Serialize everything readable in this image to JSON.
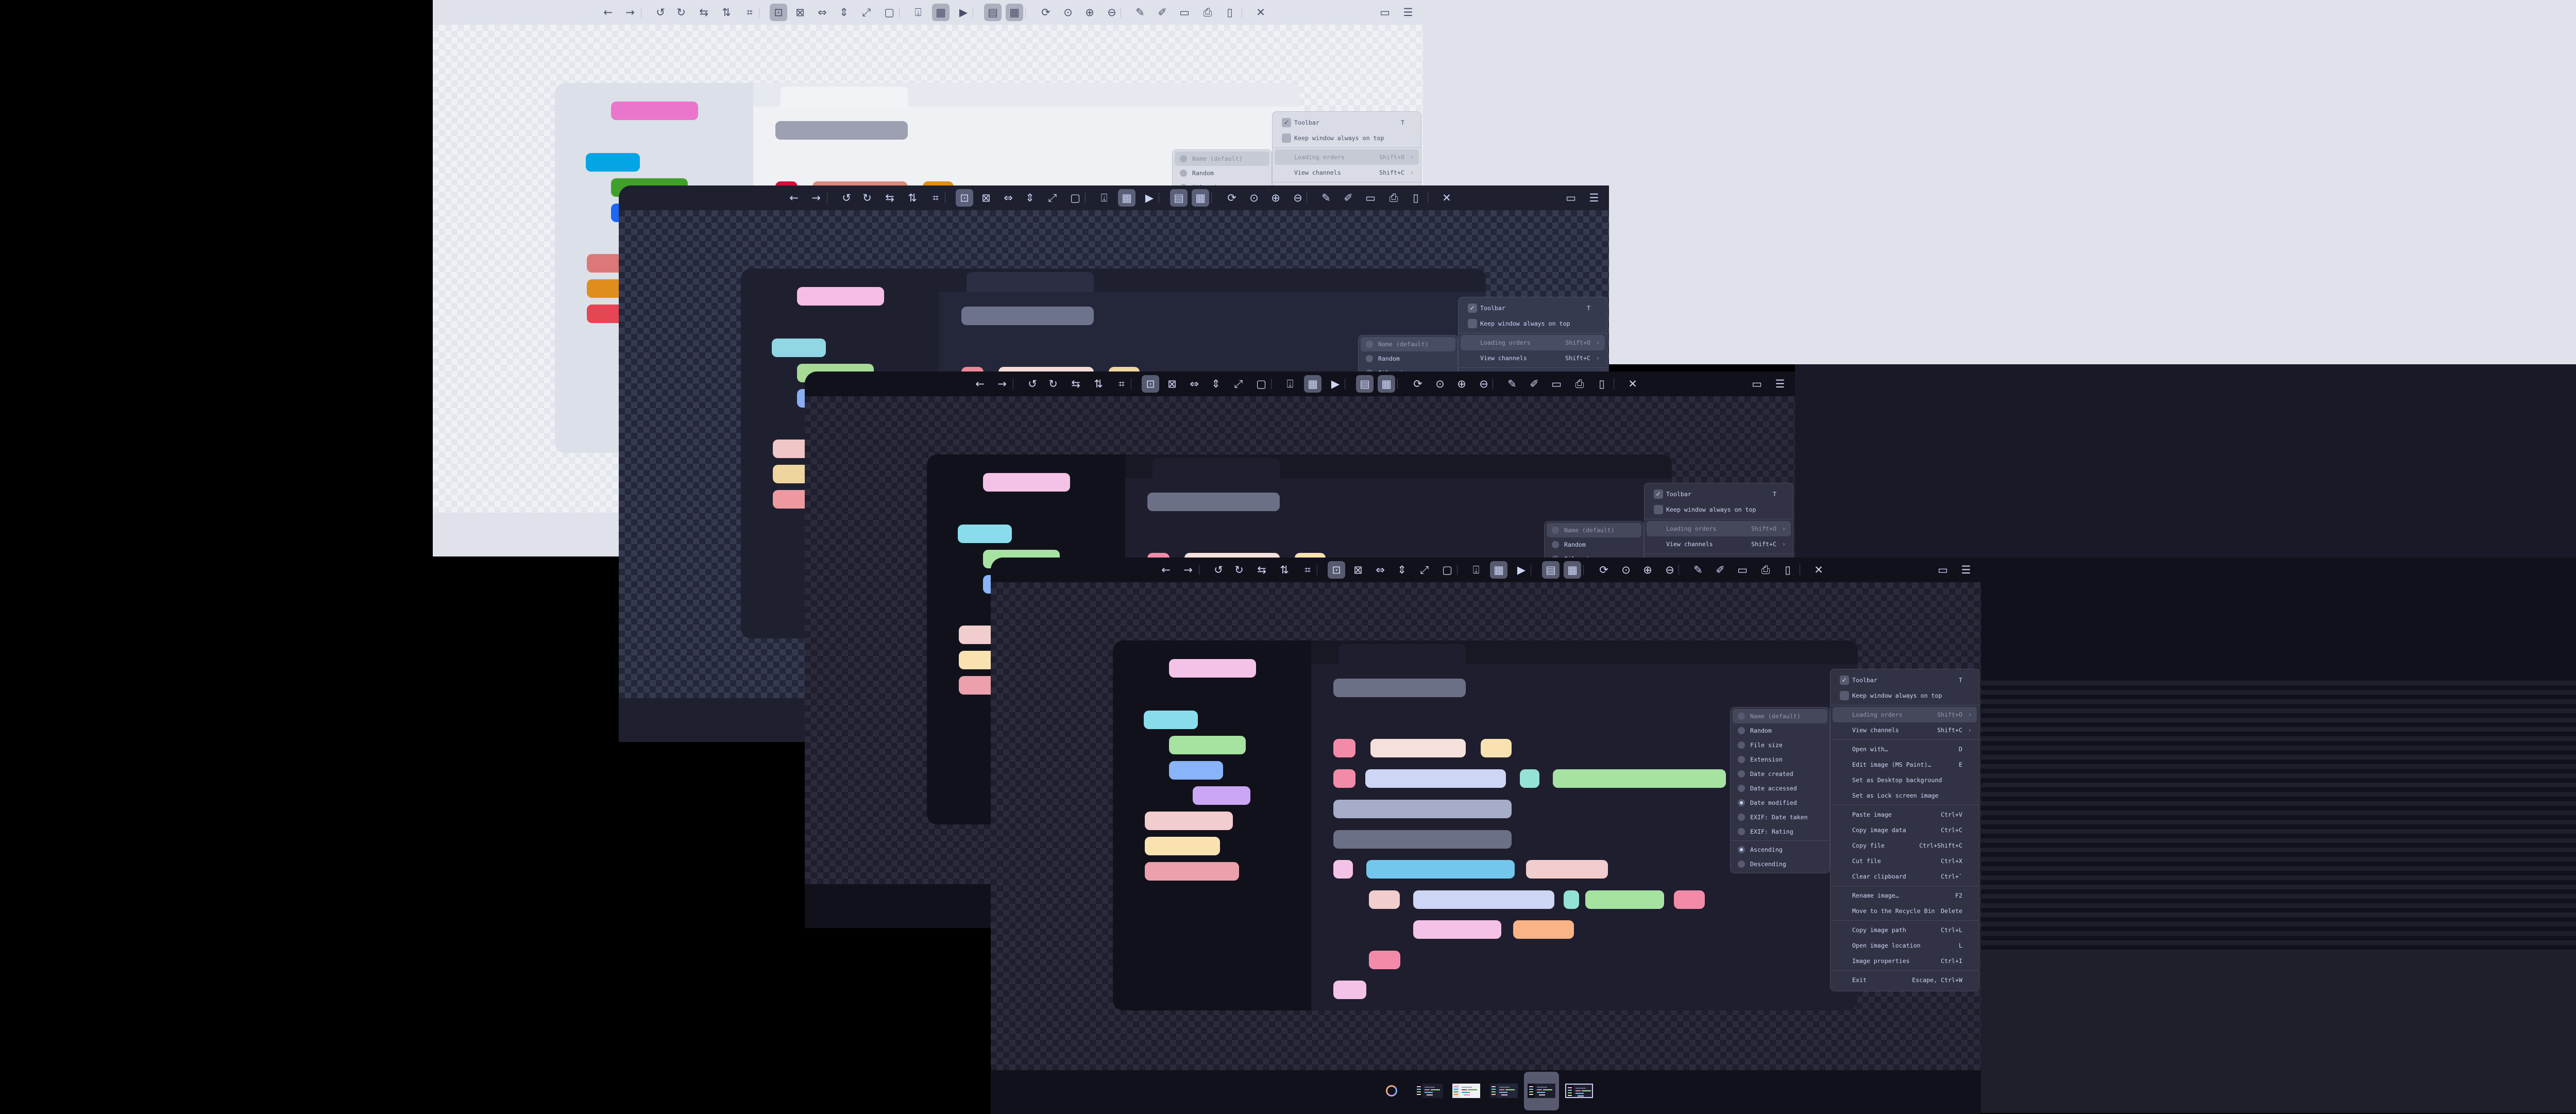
{
  "toolbar": {
    "items": [
      {
        "icon": "arrow-left-icon",
        "label": "Previous image",
        "active": false
      },
      {
        "icon": "arrow-right-icon",
        "label": "Next image",
        "active": false
      },
      {
        "icon": "rotate-left-icon",
        "label": "Rotate left",
        "active": false
      },
      {
        "icon": "rotate-right-icon",
        "label": "Rotate right",
        "active": false
      },
      {
        "icon": "flip-horizontal-icon",
        "label": "Flip horizontal",
        "active": false
      },
      {
        "icon": "flip-vertical-icon",
        "label": "Flip vertical",
        "active": false
      },
      {
        "icon": "crop-icon",
        "label": "Crop",
        "active": false
      },
      {
        "icon": "auto-zoom-icon",
        "label": "Auto zoom",
        "active": true
      },
      {
        "icon": "lock-zoom-icon",
        "label": "Lock zoom",
        "active": false
      },
      {
        "icon": "scale-to-width-icon",
        "label": "Scale to width",
        "active": false
      },
      {
        "icon": "scale-to-height-icon",
        "label": "Scale to height",
        "active": false
      },
      {
        "icon": "scale-to-fill-icon",
        "label": "Scale to fill",
        "active": false
      },
      {
        "icon": "original-size-icon",
        "label": "Original size",
        "active": false
      },
      {
        "icon": "toggle-toolbar-icon",
        "label": "Toolbar",
        "active": false
      },
      {
        "icon": "checkerboard-icon",
        "label": "Checkerboard",
        "active": true
      },
      {
        "icon": "slideshow-icon",
        "label": "Slideshow",
        "active": false
      },
      {
        "icon": "thumbnail-bar-icon",
        "label": "Thumbnail bar",
        "active": true
      },
      {
        "icon": "gallery-icon",
        "label": "Gallery",
        "active": true
      },
      {
        "icon": "refresh-icon",
        "label": "Refresh",
        "active": false
      },
      {
        "icon": "zoom-fit-icon",
        "label": "Zoom to fit",
        "active": false
      },
      {
        "icon": "zoom-in-icon",
        "label": "Zoom in",
        "active": false
      },
      {
        "icon": "zoom-out-icon",
        "label": "Zoom out",
        "active": false
      },
      {
        "icon": "color-picker-icon",
        "label": "Color picker",
        "active": false
      },
      {
        "icon": "edit-icon",
        "label": "Edit",
        "active": false
      },
      {
        "icon": "save-icon",
        "label": "Save",
        "active": false
      },
      {
        "icon": "print-icon",
        "label": "Print",
        "active": false
      },
      {
        "icon": "delete-icon",
        "label": "Delete",
        "active": false
      },
      {
        "icon": "close-icon",
        "label": "Close",
        "active": false
      }
    ],
    "right_items": [
      {
        "icon": "folder-icon",
        "label": "Open file"
      },
      {
        "icon": "hamburger-menu-icon",
        "label": "Main menu"
      }
    ]
  },
  "context_menu": {
    "sections": [
      [
        {
          "label": "Toolbar",
          "shortcut": "T",
          "checkbox": true,
          "checked": true
        },
        {
          "label": "Keep window always on top",
          "shortcut": "",
          "checkbox": true,
          "checked": false
        }
      ],
      [
        {
          "label": "Loading orders",
          "shortcut": "Shift+O",
          "submenu": true,
          "highlighted": true
        },
        {
          "label": "View channels",
          "shortcut": "Shift+C",
          "submenu": true
        }
      ],
      [
        {
          "label": "Open with…",
          "shortcut": "D"
        },
        {
          "label": "Edit image (MS Paint)…",
          "shortcut": "E"
        },
        {
          "label": "Set as Desktop background",
          "shortcut": ""
        },
        {
          "label": "Set as Lock screen image",
          "shortcut": ""
        }
      ],
      [
        {
          "label": "Paste image",
          "shortcut": "Ctrl+V"
        },
        {
          "label": "Copy image data",
          "shortcut": "Ctrl+C"
        },
        {
          "label": "Copy file",
          "shortcut": "Ctrl+Shift+C"
        },
        {
          "label": "Cut file",
          "shortcut": "Ctrl+X"
        },
        {
          "label": "Clear clipboard",
          "shortcut": "Ctrl+`"
        }
      ],
      [
        {
          "label": "Rename image…",
          "shortcut": "F2"
        },
        {
          "label": "Move to the Recycle Bin",
          "shortcut": "Delete"
        }
      ],
      [
        {
          "label": "Copy image path",
          "shortcut": "Ctrl+L"
        },
        {
          "label": "Open image location",
          "shortcut": "L"
        },
        {
          "label": "Image properties",
          "shortcut": "Ctrl+I"
        }
      ],
      [
        {
          "label": "Exit",
          "shortcut": "Escape, Ctrl+W"
        }
      ]
    ]
  },
  "loading_orders_submenu": {
    "sections": [
      [
        {
          "label": "Name (default)",
          "selected": false,
          "highlighted": true
        },
        {
          "label": "Random",
          "selected": false
        },
        {
          "label": "File size",
          "selected": false
        },
        {
          "label": "Extension",
          "selected": false
        },
        {
          "label": "Date created",
          "selected": false
        },
        {
          "label": "Date accessed",
          "selected": false
        },
        {
          "label": "Date modified",
          "selected": true
        },
        {
          "label": "EXIF: Date taken",
          "selected": false
        },
        {
          "label": "EXIF: Rating",
          "selected": false
        }
      ],
      [
        {
          "label": "Ascending",
          "selected": true
        },
        {
          "label": "Descending",
          "selected": false
        }
      ]
    ]
  },
  "thumbnails": {
    "items": [
      {
        "theme": "mocha"
      },
      {
        "theme": "latte"
      },
      {
        "theme": "macchiato"
      },
      {
        "theme": "mocha"
      },
      {
        "theme": "mocha"
      }
    ],
    "selected_index": 3
  },
  "themes": {
    "latte": {
      "bar": "#dfe2ea",
      "checkA": "#eff1f5",
      "checkB": "#e3e6ed",
      "icon": "#4c4f69",
      "active": "#acb0be",
      "sep": "#bcc0cc",
      "edSide": "#dce0e8",
      "edMain": "#eff1f5",
      "edTabbar": "#e6e9ef",
      "edTab": "#f2f3f7",
      "menuBg": "#d9dce4",
      "menuBorder": "#bcc0cc",
      "menuText": "#4c4f69",
      "menuDim": "#8c8fa1",
      "menuHl": "#c6cad4",
      "box": "#acb0be",
      "pink": "#ea76cb",
      "sky": "#04a5e5",
      "green": "#40a02b",
      "blue": "#1e66f5",
      "mauve": "#8839ef",
      "flamingo": "#dd7878",
      "yellow": "#df8e1d",
      "maroon": "#e64553",
      "red": "#d20f39",
      "overlay": "#9ca0b0",
      "overlay2": "#acb0be",
      "teal": "#179299",
      "sapphire": "#209fb5",
      "peach": "#fe640b",
      "rosewater": "#dc8a78",
      "text": "#7287fd"
    },
    "macchiato": {
      "bar": "#1e2030",
      "checkA": "#363a4f",
      "checkB": "#24273a",
      "icon": "#cad3f5",
      "active": "#5b6078",
      "sep": "#494d64",
      "edSide": "#1e2030",
      "edMain": "#24273a",
      "edTabbar": "#1e2030",
      "edTab": "#2c2f43",
      "menuBg": "#363a4f",
      "menuBorder": "#494d64",
      "menuText": "#cad3f5",
      "menuDim": "#939ab7",
      "menuHl": "#494d64",
      "box": "#5b6078",
      "pink": "#f5bde6",
      "sky": "#91d7e3",
      "green": "#a6da95",
      "blue": "#8aadf4",
      "mauve": "#c6a0f6",
      "flamingo": "#f0c6c6",
      "yellow": "#eed49f",
      "maroon": "#ee99a0",
      "red": "#ed8796",
      "overlay": "#6e738d",
      "overlay2": "#a5adcb",
      "teal": "#8bd5ca",
      "sapphire": "#7dc4e4",
      "peach": "#f5a97f",
      "rosewater": "#f4dbd6",
      "text": "#cad3f5"
    },
    "mocha": {
      "bar": "#11111b",
      "checkA": "#2b2b3b",
      "checkB": "#1e1e2e",
      "icon": "#cdd6f4",
      "active": "#585b70",
      "sep": "#45475a",
      "edSide": "#11111b",
      "edMain": "#1e1e2e",
      "edTabbar": "#181825",
      "edTab": "#1e1e2e",
      "menuBg": "#313244",
      "menuBorder": "#45475a",
      "menuText": "#cdd6f4",
      "menuDim": "#9399b2",
      "menuHl": "#45475a",
      "box": "#585b70",
      "pink": "#f5c2e7",
      "sky": "#89dceb",
      "green": "#a6e3a1",
      "blue": "#89b4fa",
      "mauve": "#cba6f7",
      "flamingo": "#f2cdcd",
      "yellow": "#f9e2af",
      "maroon": "#eba0ac",
      "red": "#f38ba8",
      "overlay": "#6c7086",
      "overlay2": "#a6adc8",
      "teal": "#94e2d5",
      "sapphire": "#74c7ec",
      "peach": "#fab387",
      "rosewater": "#f5e0dc",
      "text": "#cdd6f4"
    }
  },
  "windows": [
    {
      "theme": "latte"
    },
    {
      "theme": "macchiato"
    },
    {
      "theme": "mocha"
    },
    {
      "theme": "mocha"
    }
  ]
}
